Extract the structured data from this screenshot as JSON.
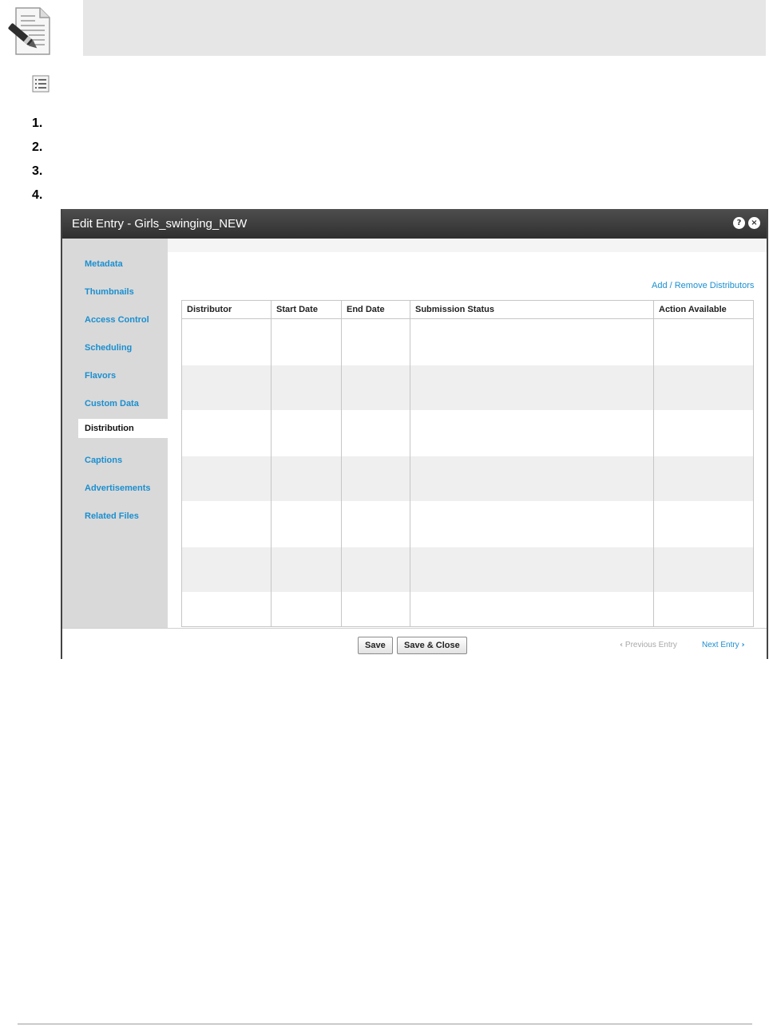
{
  "note": {
    "icon": "note-pen-icon"
  },
  "list_icon": "list-icon",
  "steps": [
    "1.",
    "2.",
    "3.",
    "4."
  ],
  "dialog": {
    "title": "Edit Entry - Girls_swinging_NEW",
    "help_glyph": "?",
    "close_glyph": "×",
    "sidebar": {
      "items": [
        {
          "label": "Metadata",
          "active": false
        },
        {
          "label": "Thumbnails",
          "active": false
        },
        {
          "label": "Access Control",
          "active": false
        },
        {
          "label": "Scheduling",
          "active": false
        },
        {
          "label": "Flavors",
          "active": false
        },
        {
          "label": "Custom Data",
          "active": false
        },
        {
          "label": "Distribution",
          "active": true
        },
        {
          "label": "Captions",
          "active": false
        },
        {
          "label": "Advertisements",
          "active": false
        },
        {
          "label": "Related Files",
          "active": false
        }
      ]
    },
    "distribution": {
      "add_remove_link": "Add / Remove Distributors",
      "columns": [
        "Distributor",
        "Start Date",
        "End Date",
        "Submission Status",
        "Action Available"
      ],
      "rows": [
        [],
        [],
        [],
        [],
        [],
        [],
        []
      ]
    },
    "footer": {
      "save": "Save",
      "save_close": "Save & Close",
      "previous_entry": "Previous Entry",
      "next_entry": "Next Entry",
      "prev_chevron": "‹",
      "next_chevron": "›"
    }
  }
}
